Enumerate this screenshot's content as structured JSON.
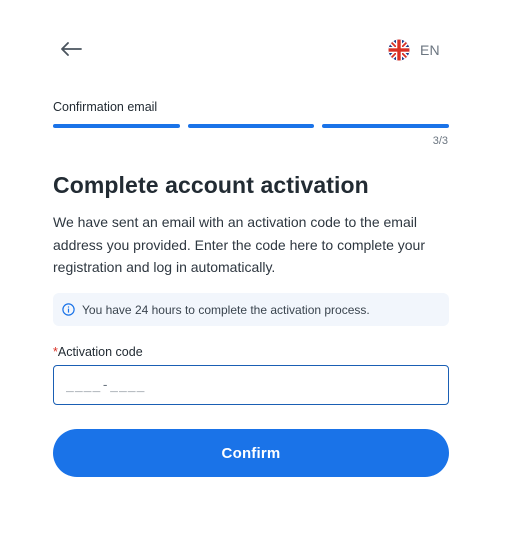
{
  "header": {
    "back_icon": "arrow-left-icon",
    "language": {
      "flag_icon": "uk-flag-icon",
      "code": "EN"
    }
  },
  "progress": {
    "step_label": "Confirmation email",
    "current_step": 3,
    "total_steps": 3,
    "step_count_text": "3/3",
    "bar_color": "#1a73e8"
  },
  "main": {
    "title": "Complete account activation",
    "description": "We have sent an email with an activation code to the email address you provided. Enter the code here to complete your registration and log in automatically.",
    "info": {
      "icon": "info-icon",
      "text": "You have 24 hours to complete the activation process."
    },
    "activation_field": {
      "required_mark": "*",
      "label": "Activation code",
      "value": "",
      "placeholder": "____-____"
    },
    "confirm_label": "Confirm"
  },
  "colors": {
    "accent": "#1a73e8",
    "info_background": "#f2f6fc",
    "required": "#d93025"
  }
}
